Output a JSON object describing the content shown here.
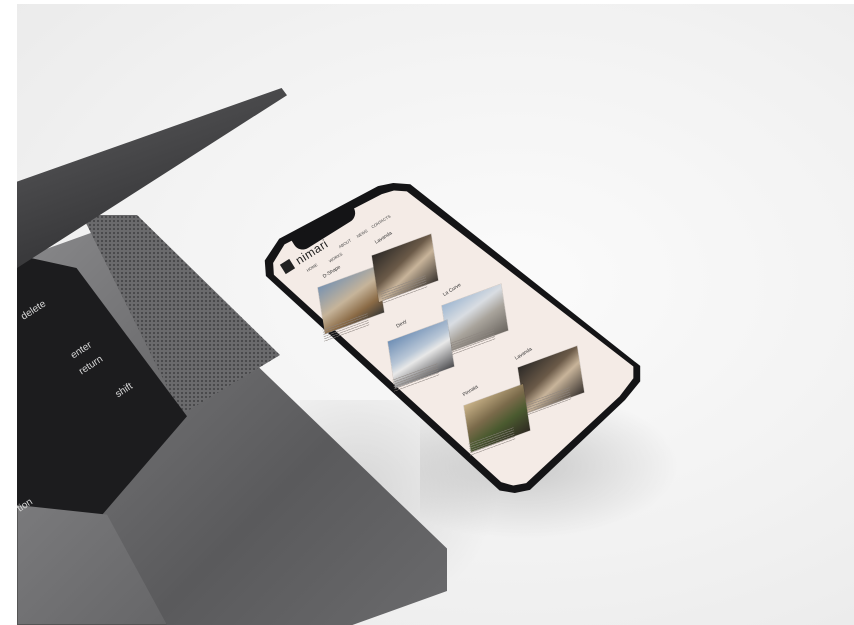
{
  "scene": {
    "background": "#f2f2f2",
    "laptop_color": "#6e6e70",
    "phone_color": "#141416",
    "screen_color": "#f4ebe6"
  },
  "laptop": {
    "keys": {
      "delete": "delete",
      "enter": "enter",
      "return": "return",
      "shift": "shift",
      "option": "tion"
    }
  },
  "site": {
    "logo": "nimari",
    "nav": [
      "HOME",
      "WORKS",
      "ABOUT",
      "NEWS",
      "CONTACTS"
    ],
    "projects": [
      {
        "title": "D-Shape",
        "subtitle": "Dubai"
      },
      {
        "title": "Lavanda",
        "subtitle": "Italy"
      },
      {
        "title": "La Curve",
        "subtitle": "Monaco"
      },
      {
        "title": "Dexy",
        "subtitle": "Japan"
      },
      {
        "title": "Lavanda",
        "subtitle": "Italy"
      },
      {
        "title": "Pinnata",
        "subtitle": "Norway"
      }
    ]
  }
}
